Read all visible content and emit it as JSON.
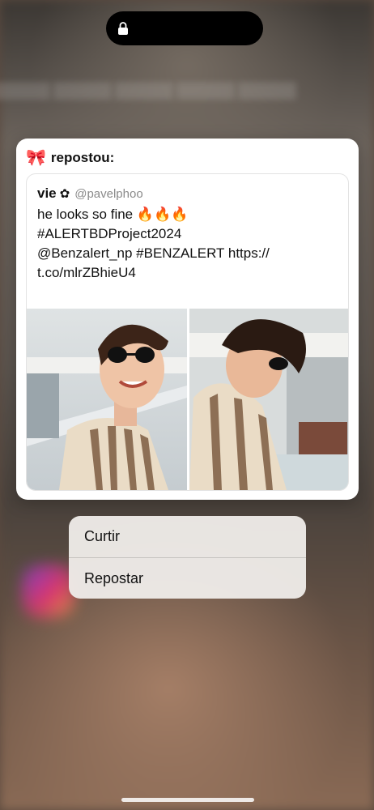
{
  "card": {
    "header_icon": "ribbon-bow-emoji",
    "bow_glyph": "🎀",
    "repost_label": "repostou:"
  },
  "tweet": {
    "author_name": "vie",
    "flower_glyph": "✿",
    "author_handle": "@pavelphoo",
    "line1": "he looks so fine 🔥🔥🔥",
    "line2": "",
    "line3": "#ALERTBDProject2024",
    "line4": "@Benzalert_np #BENZALERT https://",
    "line5": "t.co/mlrZBhieU4"
  },
  "menu": {
    "items": [
      {
        "label": "Curtir"
      },
      {
        "label": "Repostar"
      }
    ]
  },
  "colors": {
    "card_bg": "#ffffff",
    "menu_bg": "#eeebe8",
    "island": "#000000",
    "handle": "#8a8a8a"
  }
}
